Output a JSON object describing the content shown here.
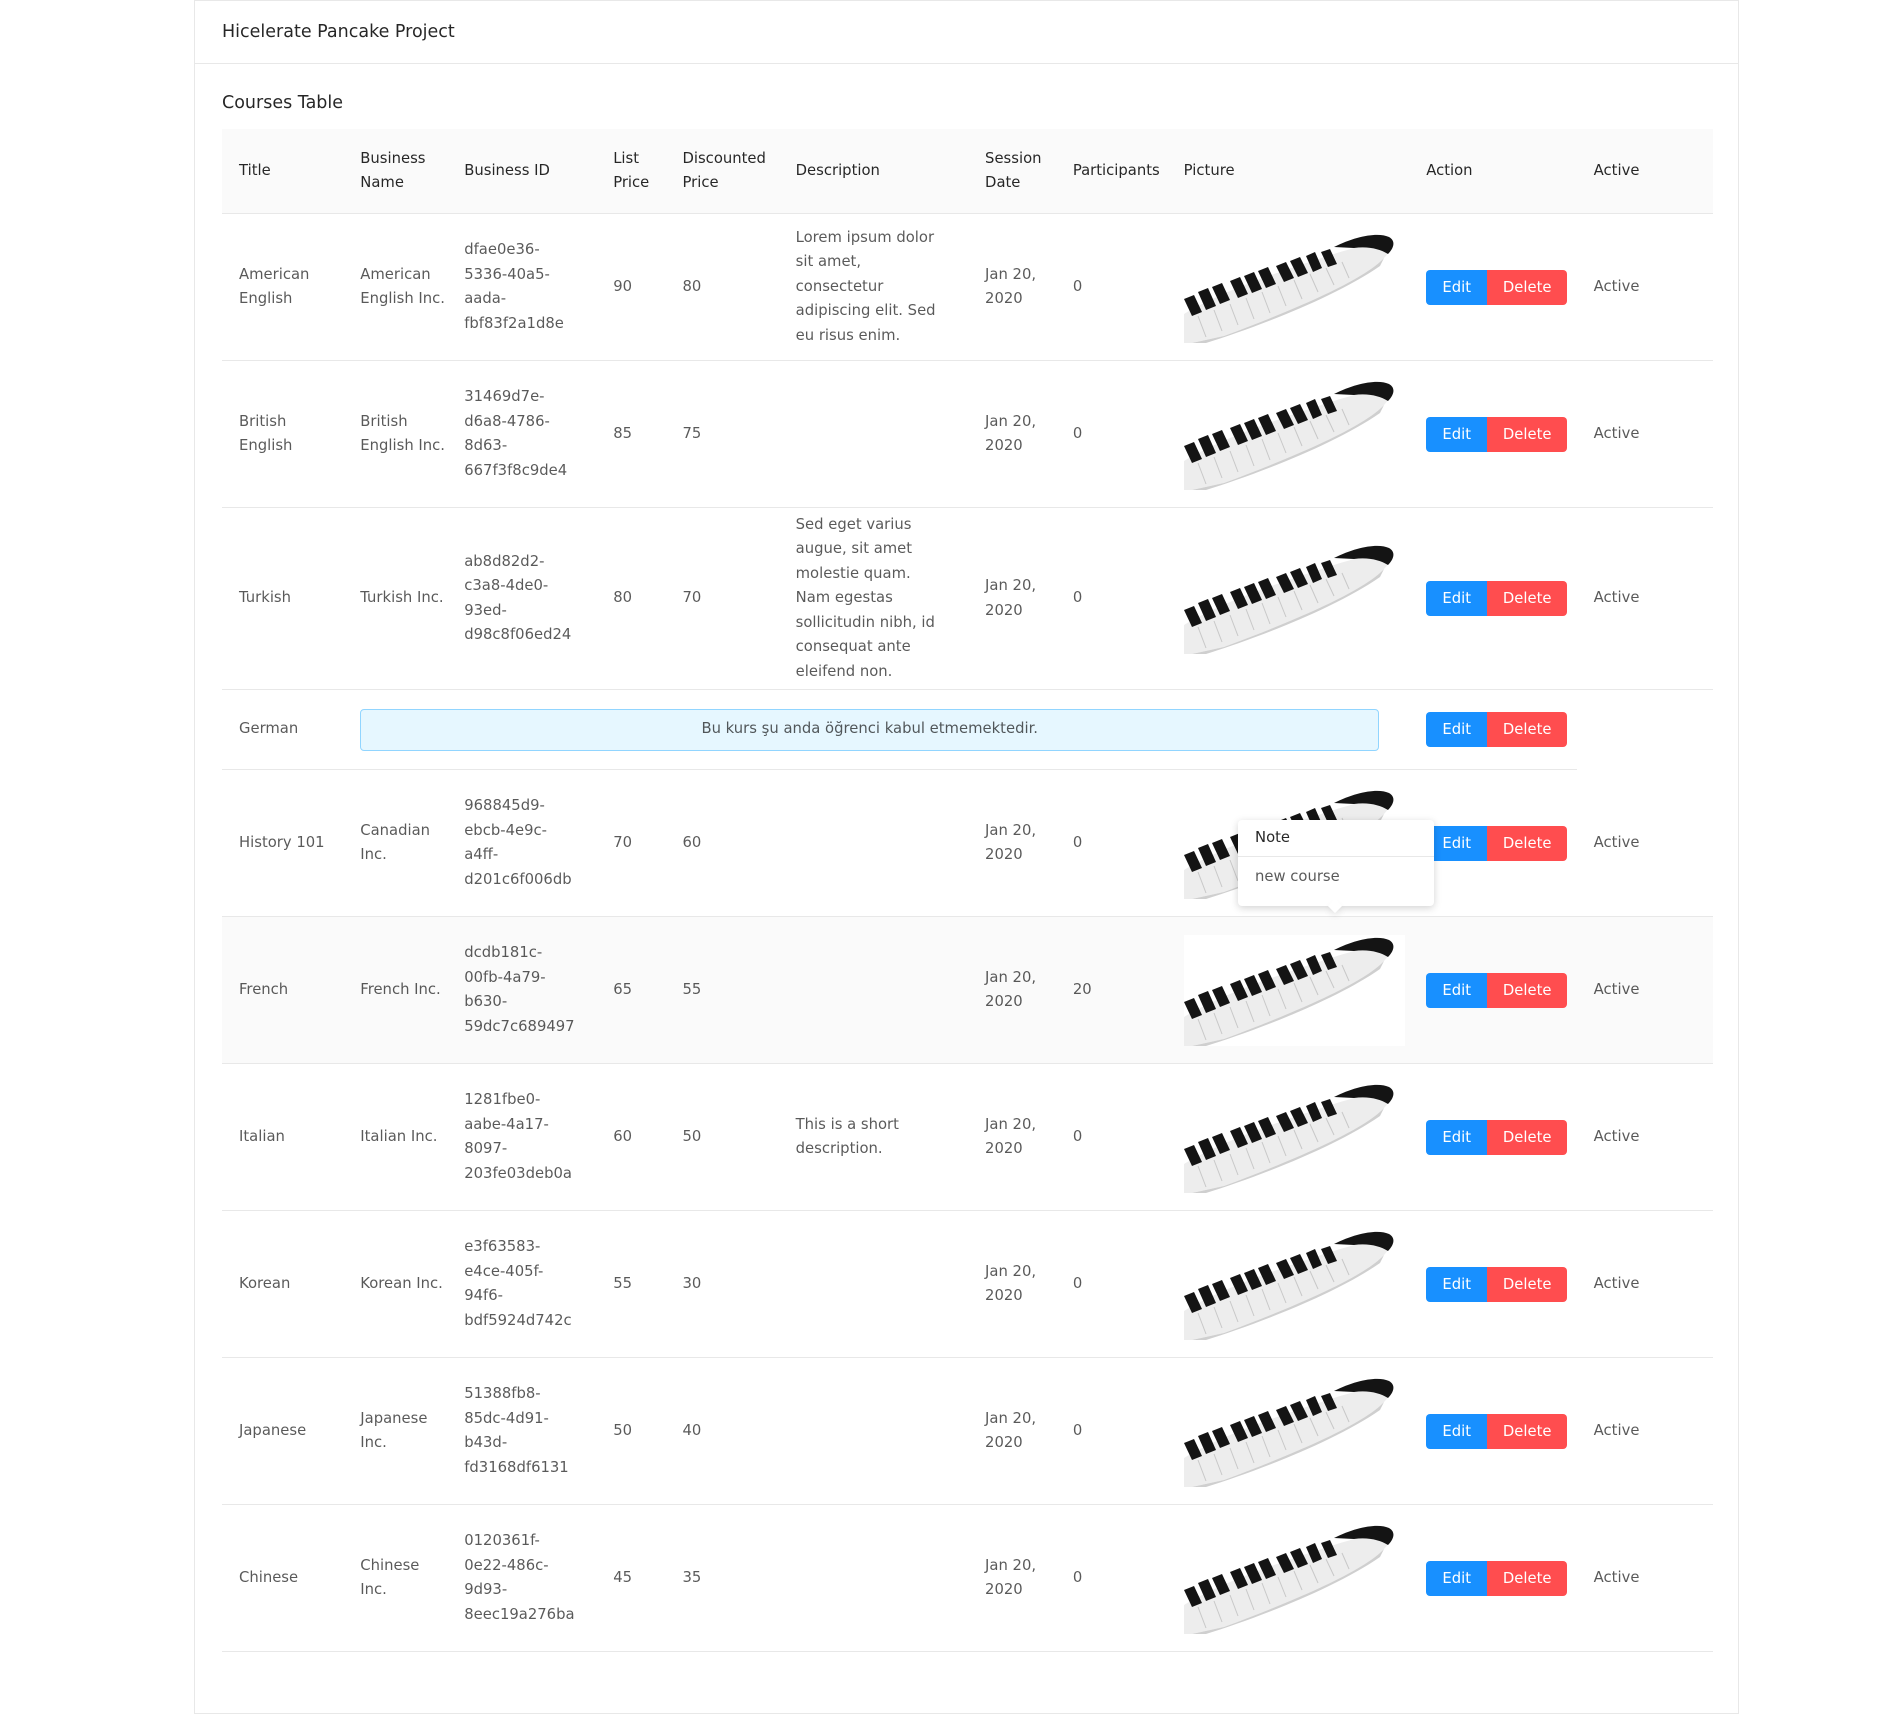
{
  "header": {
    "title": "Hicelerate Pancake Project"
  },
  "section": {
    "title": "Courses Table"
  },
  "columns": {
    "title": "Title",
    "business_name": "Business Name",
    "business_id": "Business ID",
    "list_price": "List Price",
    "discounted_price": "Discounted Price",
    "description": "Description",
    "session_date": "Session Date",
    "participants": "Participants",
    "picture": "Picture",
    "action": "Action",
    "active": "Active"
  },
  "buttons": {
    "edit": "Edit",
    "delete": "Delete"
  },
  "rows": [
    {
      "title": "American English",
      "business_name": "American English Inc.",
      "business_id": "dfae0e36-5336-40a5-aada-fbf83f2a1d8e",
      "list_price": "90",
      "discounted_price": "80",
      "description": "Lorem ipsum dolor sit amet, consectetur adipiscing elit. Sed eu risus enim.",
      "session_date": "Jan 20, 2020",
      "participants": "0",
      "active": "Active"
    },
    {
      "title": "British English",
      "business_name": "British English Inc.",
      "business_id": "31469d7e-d6a8-4786-8d63-667f3f8c9de4",
      "list_price": "85",
      "discounted_price": "75",
      "description": "",
      "session_date": "Jan 20, 2020",
      "participants": "0",
      "active": "Active"
    },
    {
      "title": "Turkish",
      "business_name": "Turkish Inc.",
      "business_id": "ab8d82d2-c3a8-4de0-93ed-d98c8f06ed24",
      "list_price": "80",
      "discounted_price": "70",
      "description": "Sed eget varius augue, sit amet molestie quam. Nam egestas sollicitudin nibh, id consequat ante eleifend non.",
      "session_date": "Jan 20, 2020",
      "participants": "0",
      "active": "Active"
    },
    {
      "title": "German",
      "notice": "Bu kurs şu anda öğrenci kabul etmemektedir."
    },
    {
      "title": "History 101",
      "business_name": "Canadian Inc.",
      "business_id": "968845d9-ebcb-4e9c-a4ff-d201c6f006db",
      "list_price": "70",
      "discounted_price": "60",
      "description": "",
      "session_date": "Jan 20, 2020",
      "participants": "0",
      "active": "Active"
    },
    {
      "title": "French",
      "business_name": "French Inc.",
      "business_id": "dcdb181c-00fb-4a79-b630-59dc7c689497",
      "list_price": "65",
      "discounted_price": "55",
      "description": "",
      "session_date": "Jan 20, 2020",
      "participants": "20",
      "active": "Active"
    },
    {
      "title": "Italian",
      "business_name": "Italian Inc.",
      "business_id": "1281fbe0-aabe-4a17-8097-203fe03deb0a",
      "list_price": "60",
      "discounted_price": "50",
      "description": "This is a short description.",
      "session_date": "Jan 20, 2020",
      "participants": "0",
      "active": "Active"
    },
    {
      "title": "Korean",
      "business_name": "Korean Inc.",
      "business_id": "e3f63583-e4ce-405f-94f6-bdf5924d742c",
      "list_price": "55",
      "discounted_price": "30",
      "description": "",
      "session_date": "Jan 20, 2020",
      "participants": "0",
      "active": "Active"
    },
    {
      "title": "Japanese",
      "business_name": "Japanese Inc.",
      "business_id": "51388fb8-85dc-4d91-b43d-fd3168df6131",
      "list_price": "50",
      "discounted_price": "40",
      "description": "",
      "session_date": "Jan 20, 2020",
      "participants": "0",
      "active": "Active"
    },
    {
      "title": "Chinese",
      "business_name": "Chinese Inc.",
      "business_id": "0120361f-0e22-486c-9d93-8eec19a276ba",
      "list_price": "45",
      "discounted_price": "35",
      "description": "",
      "session_date": "Jan 20, 2020",
      "participants": "0",
      "active": "Active"
    }
  ],
  "popover": {
    "title": "Note",
    "content": "new course"
  },
  "icons": {
    "picture": "piano-keyboard-image"
  },
  "colors": {
    "edit": "#1890ff",
    "delete": "#ff4d4f",
    "notice_bg": "#e6f7ff",
    "notice_border": "#91d5ff"
  }
}
